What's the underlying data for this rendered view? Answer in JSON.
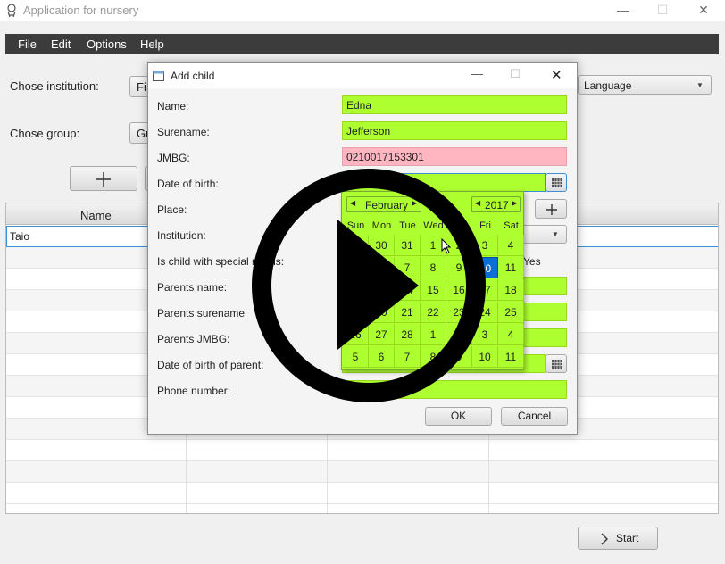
{
  "window": {
    "title": "Application for nursery"
  },
  "menu": [
    "File",
    "Edit",
    "Options",
    "Help"
  ],
  "main": {
    "institution_label": "Chose institution:",
    "institution_value": "Fi",
    "group_label": "Chose group:",
    "group_value": "Gr",
    "language_value": "Language",
    "table": {
      "header_name": "Name",
      "first_row_name": "Taio"
    },
    "start_label": "Start"
  },
  "dialog": {
    "title": "Add child",
    "labels": {
      "name": "Name:",
      "surname": "Surename:",
      "jmbg": "JMBG:",
      "dob": "Date of birth:",
      "place": "Place:",
      "institution": "Institution:",
      "special": "Is child with special needs:",
      "parents_name": "Parents name:",
      "parents_surname": "Parents surename",
      "parents_jmbg": "Parents JMBG:",
      "parent_dob": "Date of birth of parent:",
      "phone": "Phone number:"
    },
    "values": {
      "name": "Edna",
      "surname": "Jefferson",
      "jmbg": "0210017153301",
      "dob": "2/10/2017",
      "special_yes": "Yes"
    },
    "ok": "OK",
    "cancel": "Cancel"
  },
  "calendar": {
    "month": "February",
    "year": "2017",
    "weekdays": [
      "Sun",
      "Mon",
      "Tue",
      "Wed",
      "Thu",
      "Fri",
      "Sat"
    ],
    "days": [
      [
        "29",
        "30",
        "31",
        "1",
        "2",
        "3",
        "4"
      ],
      [
        "5",
        "6",
        "7",
        "8",
        "9",
        "10",
        "11"
      ],
      [
        "12",
        "13",
        "14",
        "15",
        "16",
        "17",
        "18"
      ],
      [
        "19",
        "20",
        "21",
        "22",
        "23",
        "24",
        "25"
      ],
      [
        "26",
        "27",
        "28",
        "1",
        "2",
        "3",
        "4"
      ],
      [
        "5",
        "6",
        "7",
        "8",
        "9",
        "10",
        "11"
      ]
    ],
    "selected": "10"
  }
}
